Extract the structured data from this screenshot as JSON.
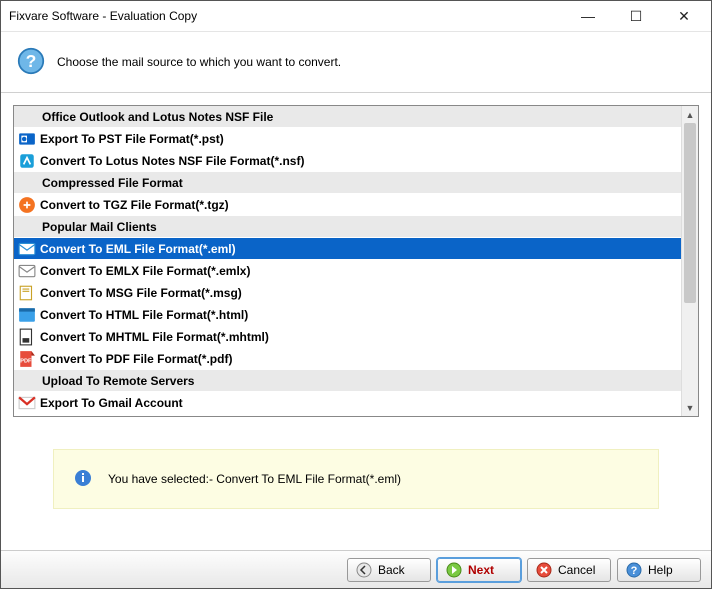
{
  "window": {
    "title": "Fixvare Software - Evaluation Copy"
  },
  "instruction": "Choose the mail source to which you want to convert.",
  "list": [
    {
      "type": "header",
      "label": "Office Outlook and Lotus Notes NSF File"
    },
    {
      "type": "item",
      "icon": "outlook",
      "label": "Export To PST File Format(*.pst)"
    },
    {
      "type": "item",
      "icon": "lotus",
      "label": "Convert To Lotus Notes NSF File Format(*.nsf)"
    },
    {
      "type": "header",
      "label": "Compressed File Format"
    },
    {
      "type": "item",
      "icon": "tgz",
      "label": "Convert to TGZ File Format(*.tgz)"
    },
    {
      "type": "header",
      "label": "Popular Mail Clients"
    },
    {
      "type": "item",
      "icon": "eml",
      "label": "Convert To EML File Format(*.eml)",
      "selected": true
    },
    {
      "type": "item",
      "icon": "emlx",
      "label": "Convert To EMLX File Format(*.emlx)"
    },
    {
      "type": "item",
      "icon": "msg",
      "label": "Convert To MSG File Format(*.msg)"
    },
    {
      "type": "item",
      "icon": "html",
      "label": "Convert To HTML File Format(*.html)"
    },
    {
      "type": "item",
      "icon": "mhtml",
      "label": "Convert To MHTML File Format(*.mhtml)"
    },
    {
      "type": "item",
      "icon": "pdf",
      "label": "Convert To PDF File Format(*.pdf)"
    },
    {
      "type": "header",
      "label": "Upload To Remote Servers"
    },
    {
      "type": "item",
      "icon": "gmail",
      "label": "Export To Gmail Account"
    }
  ],
  "status": "You have selected:- Convert To EML File Format(*.eml)",
  "buttons": {
    "back": "Back",
    "next": "Next",
    "cancel": "Cancel",
    "help": "Help"
  }
}
